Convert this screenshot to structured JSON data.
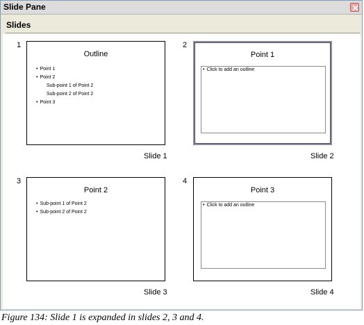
{
  "window": {
    "title": "Slide Pane",
    "close_icon": "close-icon"
  },
  "section": {
    "label": "Slides"
  },
  "slides": [
    {
      "number": "1",
      "caption": "Slide 1",
      "title": "Outline",
      "bullets": [
        "Point 1",
        "Point 2",
        "Sub-point 1 of Point 2",
        "Sub-point 2 of Point 2",
        "Point 3"
      ]
    },
    {
      "number": "2",
      "caption": "Slide 2",
      "title": "Point 1",
      "placeholder": "Click to add an outline"
    },
    {
      "number": "3",
      "caption": "Slide 3",
      "title": "Point 2",
      "bullets": [
        "Sub-point 1 of Point 2",
        "Sub-point 2 of Point 2"
      ]
    },
    {
      "number": "4",
      "caption": "Slide 4",
      "title": "Point 3",
      "placeholder": "Click to add an outline"
    }
  ],
  "figure_caption": "Figure 134: Slide 1 is expanded in slides 2, 3 and 4.",
  "colors": {
    "selected_border": "#8c8c9c",
    "titlebar": "#dcdcdc",
    "close": "#e8a5a5"
  }
}
